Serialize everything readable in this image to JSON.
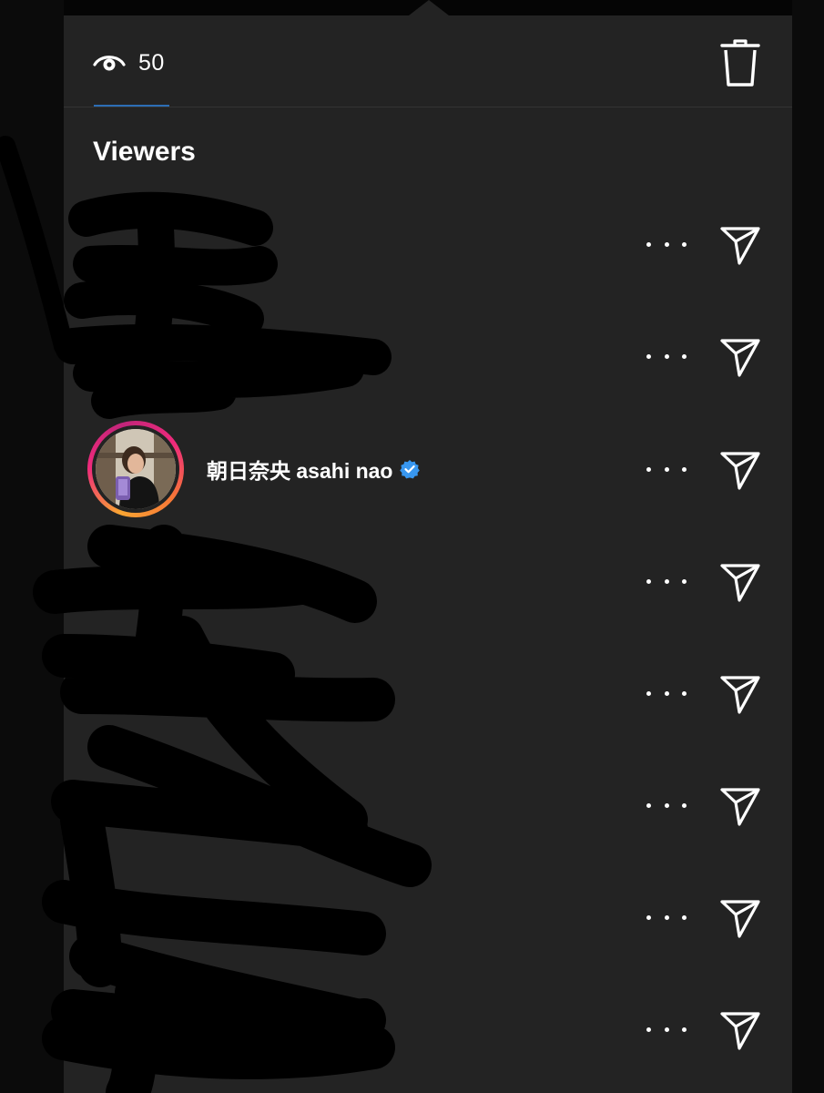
{
  "header": {
    "view_count": "50",
    "icons": {
      "eye": "eye-icon",
      "delete": "trash-icon"
    }
  },
  "viewers": {
    "title": "Viewers",
    "rows": [
      {
        "username": "",
        "redacted": true
      },
      {
        "username": "",
        "redacted": true
      },
      {
        "username": "朝日奈央 asahi nao",
        "verified": true,
        "redacted": false
      },
      {
        "username": "",
        "redacted": true
      },
      {
        "username": "",
        "redacted": true
      },
      {
        "username": "",
        "redacted": true
      },
      {
        "username": "",
        "redacted": true
      },
      {
        "username": "",
        "redacted": true
      }
    ]
  },
  "colors": {
    "sheet_background": "#232323",
    "accent_underline": "#2c6db5",
    "verified_badge": "#3897f0",
    "story_ring": "#ee2a7b",
    "redaction": "#000000"
  }
}
